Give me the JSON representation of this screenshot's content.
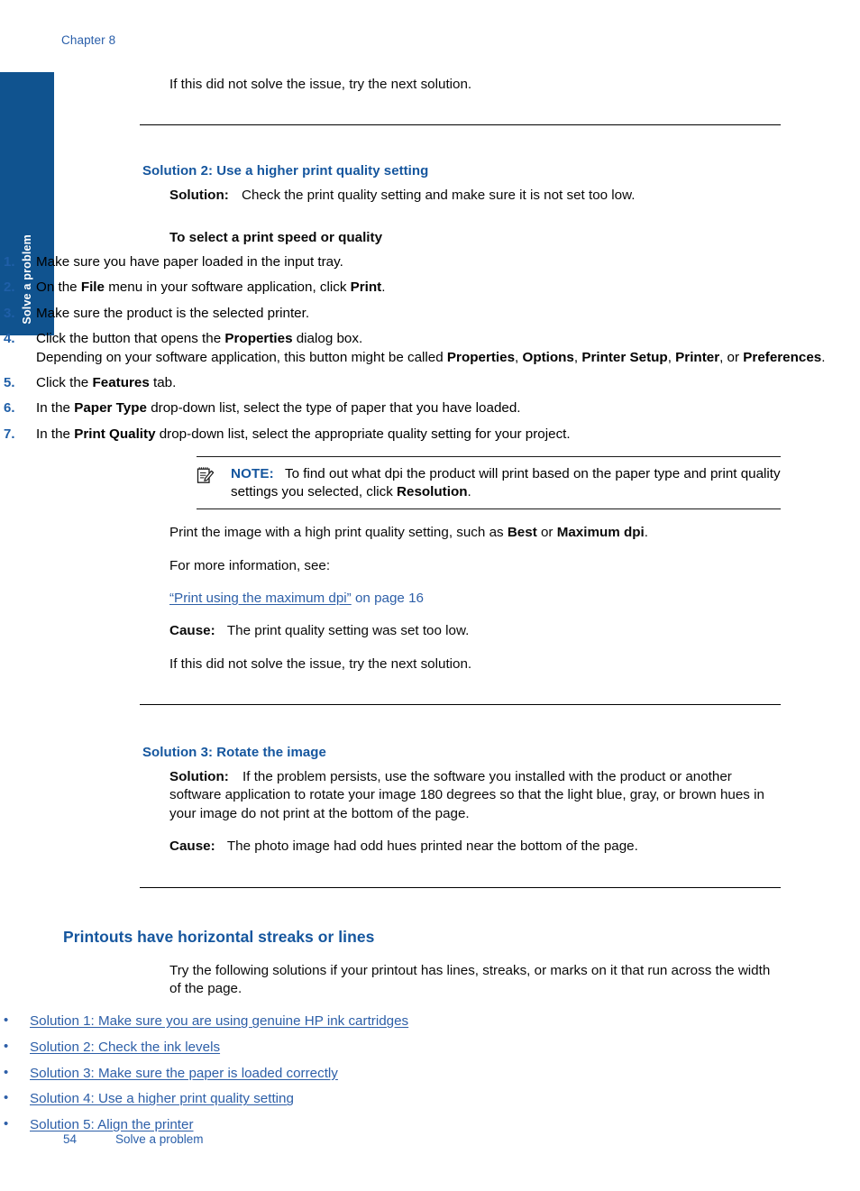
{
  "page": {
    "chapter_header": "Chapter 8",
    "side_tab_label": "Solve a problem",
    "footer_page_number": "54",
    "footer_section": "Solve a problem",
    "accent_blue": "#15569e",
    "link_blue": "#2d5fa8",
    "tab_blue": "#10538f"
  },
  "top_paragraph": "If this did not solve the issue, try the next solution.",
  "solution2": {
    "heading": "Solution 2: Use a higher print quality setting",
    "solution_label": "Solution:",
    "solution_text": "Check the print quality setting and make sure it is not set too low.",
    "procedure_title": "To select a print speed or quality",
    "steps": [
      {
        "number": "1.",
        "parts": [
          {
            "text": "Make sure you have paper loaded in the input tray.",
            "bold": false
          }
        ]
      },
      {
        "number": "2.",
        "parts": [
          {
            "text": "On the ",
            "bold": false
          },
          {
            "text": "File",
            "bold": true
          },
          {
            "text": " menu in your software application, click ",
            "bold": false
          },
          {
            "text": "Print",
            "bold": true
          },
          {
            "text": ".",
            "bold": false
          }
        ]
      },
      {
        "number": "3.",
        "parts": [
          {
            "text": "Make sure the product is the selected printer.",
            "bold": false
          }
        ]
      },
      {
        "number": "4.",
        "parts": [
          {
            "text": "Click the button that opens the ",
            "bold": false
          },
          {
            "text": "Properties",
            "bold": true
          },
          {
            "text": " dialog box.",
            "bold": false
          }
        ],
        "continuation": [
          {
            "text": "Depending on your software application, this button might be called ",
            "bold": false
          },
          {
            "text": "Properties",
            "bold": true
          },
          {
            "text": ", ",
            "bold": false
          },
          {
            "text": "Options",
            "bold": true
          },
          {
            "text": ", ",
            "bold": false
          },
          {
            "text": "Printer Setup",
            "bold": true
          },
          {
            "text": ", ",
            "bold": false
          },
          {
            "text": "Printer",
            "bold": true
          },
          {
            "text": ", or ",
            "bold": false
          },
          {
            "text": "Preferences",
            "bold": true
          },
          {
            "text": ".",
            "bold": false
          }
        ]
      },
      {
        "number": "5.",
        "parts": [
          {
            "text": "Click the ",
            "bold": false
          },
          {
            "text": "Features",
            "bold": true
          },
          {
            "text": " tab.",
            "bold": false
          }
        ]
      },
      {
        "number": "6.",
        "parts": [
          {
            "text": "In the ",
            "bold": false
          },
          {
            "text": "Paper Type",
            "bold": true
          },
          {
            "text": " drop-down list, select the type of paper that you have loaded.",
            "bold": false
          }
        ]
      },
      {
        "number": "7.",
        "parts": [
          {
            "text": "In the ",
            "bold": false
          },
          {
            "text": "Print Quality",
            "bold": true
          },
          {
            "text": " drop-down list, select the appropriate quality setting for your project.",
            "bold": false
          }
        ]
      }
    ],
    "note": {
      "icon": "note-pencil-icon",
      "label": "NOTE:",
      "parts": [
        {
          "text": "To find out what dpi the product will print based on the paper type and print quality settings you selected, click ",
          "bold": false
        },
        {
          "text": "Resolution",
          "bold": true
        },
        {
          "text": ".",
          "bold": false
        }
      ]
    },
    "after_note": [
      {
        "text": "Print the image with a high print quality setting, such as ",
        "bold": false
      },
      {
        "text": "Best",
        "bold": true
      },
      {
        "text": " or ",
        "bold": false
      },
      {
        "text": "Maximum dpi",
        "bold": true
      },
      {
        "text": ".",
        "bold": false
      }
    ],
    "more_info_label": "For more information, see:",
    "cross_reference": {
      "link_text": "“Print using the maximum dpi”",
      "tail_text": " on page 16"
    },
    "cause_label": "Cause:",
    "cause_text": "The print quality setting was set too low.",
    "closing_text": "If this did not solve the issue, try the next solution."
  },
  "solution3": {
    "heading": "Solution 3: Rotate the image",
    "solution_label": "Solution:",
    "solution_text": "If the problem persists, use the software you installed with the product or another software application to rotate your image 180 degrees so that the light blue, gray, or brown hues in your image do not print at the bottom of the page.",
    "cause_label": "Cause:",
    "cause_text": "The photo image had odd hues printed near the bottom of the page."
  },
  "streaks_section": {
    "heading": "Printouts have horizontal streaks or lines",
    "intro": "Try the following solutions if your printout has lines, streaks, or marks on it that run across the width of the page.",
    "links": [
      "Solution 1: Make sure you are using genuine HP ink cartridges",
      "Solution 2: Check the ink levels",
      "Solution 3: Make sure the paper is loaded correctly",
      "Solution 4: Use a higher print quality setting",
      "Solution 5: Align the printer"
    ],
    "bullet_glyph": "•"
  }
}
